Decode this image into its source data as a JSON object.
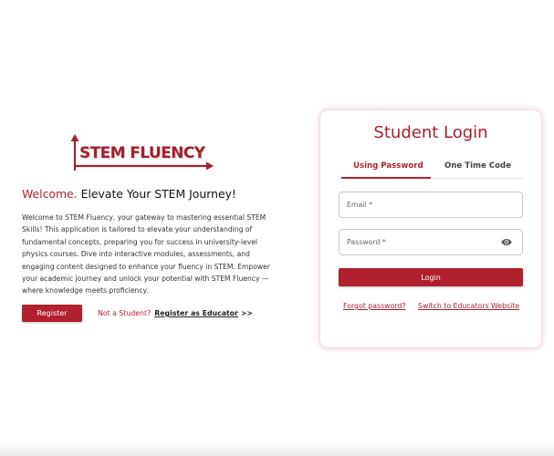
{
  "colors": {
    "brand": "#b0202f",
    "card_border": "#f3dcdf"
  },
  "logo": {
    "text": "STEM FLUENCY"
  },
  "hero": {
    "welcome": "Welcome.",
    "tagline": "Elevate Your STEM Journey!",
    "intro": "Welcome to STEM Fluency, your gateway to mastering essential STEM Skills! This application is tailored to elevate your understanding of fundamental concepts, preparing you for success in university-level physics courses. Dive into interactive modules, assessments, and engaging content designed to enhance your fluency in STEM. Empower your academic journey and unlock your potential with STEM Fluency — where knowledge meets proficiency.",
    "register_label": "Register",
    "educator_question": "Not a Student?",
    "educator_link": "Register as Educator",
    "educator_arrows": ">>"
  },
  "login": {
    "title": "Student Login",
    "tabs": [
      {
        "label": "Using Password",
        "active": true
      },
      {
        "label": "One Time Code",
        "active": false
      }
    ],
    "email_label": "Email *",
    "password_label": "Password *",
    "password_icon": "eye-icon",
    "submit_label": "Login",
    "forgot_label": "Forgot password?",
    "switch_label": "Switch to Educators Website"
  }
}
